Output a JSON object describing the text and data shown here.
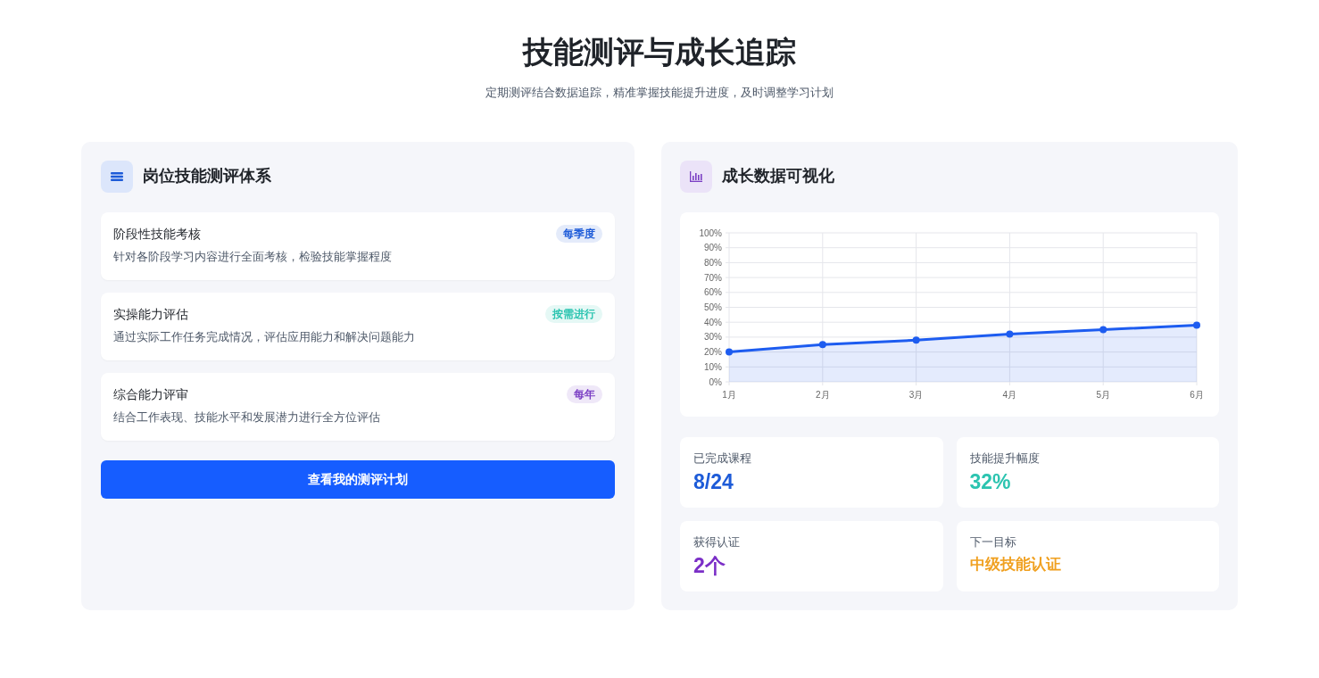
{
  "header": {
    "title": "技能测评与成长追踪",
    "subtitle": "定期测评结合数据追踪，精准掌握技能提升进度，及时调整学习计划"
  },
  "assessment_panel": {
    "title": "岗位技能测评体系",
    "items": [
      {
        "title": "阶段性技能考核",
        "description": "针对各阶段学习内容进行全面考核，检验技能掌握程度",
        "tag": "每季度",
        "color": "#1d5bd8"
      },
      {
        "title": "实操能力评估",
        "description": "通过实际工作任务完成情况，评估应用能力和解决问题能力",
        "tag": "按需进行",
        "color": "#2cc4b0"
      },
      {
        "title": "综合能力评审",
        "description": "结合工作表现、技能水平和发展潜力进行全方位评估",
        "tag": "每年",
        "color": "#7b3fc4"
      }
    ],
    "button": "查看我的测评计划"
  },
  "growth_panel": {
    "title": "成长数据可视化",
    "chart_data": {
      "type": "area",
      "categories": [
        "1月",
        "2月",
        "3月",
        "4月",
        "5月",
        "6月"
      ],
      "grid": true,
      "series": [
        {
          "color": "#1d5cf0",
          "values": [
            20,
            25,
            28,
            32,
            35,
            38
          ]
        }
      ],
      "ylim": [
        0,
        100
      ],
      "yticks": [
        {
          "value": 0,
          "label": "0%"
        },
        {
          "value": 10,
          "label": "10%"
        },
        {
          "value": 20,
          "label": "20%"
        },
        {
          "value": 30,
          "label": "30%"
        },
        {
          "value": 40,
          "label": "40%"
        },
        {
          "value": 50,
          "label": "50%"
        },
        {
          "value": 60,
          "label": "60%"
        },
        {
          "value": 70,
          "label": "70%"
        },
        {
          "value": 80,
          "label": "80%"
        },
        {
          "value": 90,
          "label": "90%"
        },
        {
          "value": 100,
          "label": "100%"
        }
      ]
    },
    "stats": [
      {
        "label": "已完成课程",
        "value": "8/24",
        "color": "#1d5bd8"
      },
      {
        "label": "技能提升幅度",
        "value": "32%",
        "color": "#2cc4b0"
      },
      {
        "label": "获得认证",
        "value": "2个",
        "color": "#7b2fc7"
      },
      {
        "label": "下一目标",
        "value": "中级技能认证",
        "color": "#f0a020"
      }
    ]
  }
}
